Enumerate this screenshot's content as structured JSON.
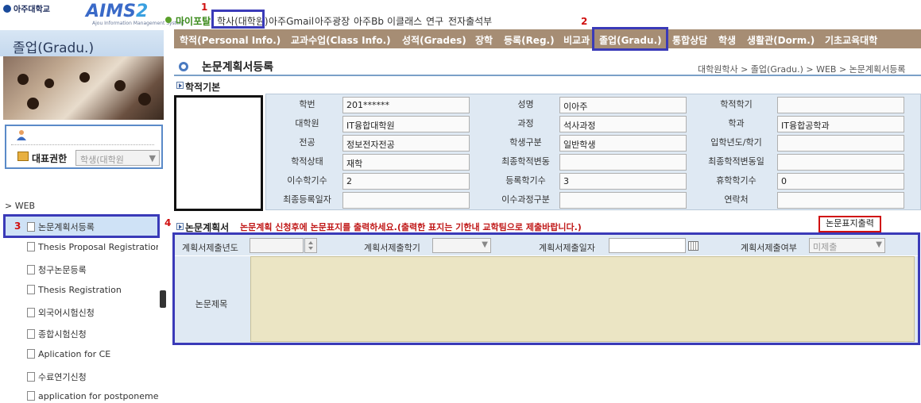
{
  "header": {
    "univ_name": "아주대학교",
    "brand": "AIMS",
    "brand_two": "2",
    "brand_sub": "Ajou Information Management System",
    "nav": [
      "마이포탈",
      "학사(대학원)",
      "아주Gmail",
      "아주광장",
      "아주Bb",
      "이클래스",
      "연구",
      "전자출석부"
    ]
  },
  "marks": [
    "1",
    "2",
    "3",
    "4"
  ],
  "sidebar": {
    "title": "졸업(Gradu.)",
    "rep_label": "대표권한",
    "rep_value": "학생(대학원",
    "rep_arrow": "▼",
    "web_label": "> WEB",
    "items": [
      "논문계획서등록",
      "Thesis Proposal Registration",
      "청구논문등록",
      "Thesis Registration",
      "외국어시험신청",
      "종합시험신청",
      "Aplication for CE",
      "수료연기신청",
      "application for postponement"
    ]
  },
  "tabs": [
    "학적(Personal Info.)",
    "교과수업(Class Info.)",
    "성적(Grades)",
    "장학",
    "등록(Reg.)",
    "비교과",
    "졸업(Gradu.)",
    "통합상담",
    "학생",
    "생활관(Dorm.)",
    "기초교육대학"
  ],
  "page": {
    "title": "논문계획서등록",
    "breadcrumb": "대학원학사 > 졸업(Gradu.) > WEB > 논문계획서등록"
  },
  "basic": {
    "section": "학적기본",
    "rows": [
      [
        {
          "l": "학번",
          "v": "201******"
        },
        {
          "l": "성명",
          "v": "이아주"
        },
        {
          "l": "학적학기",
          "v": ""
        }
      ],
      [
        {
          "l": "대학원",
          "v": "IT융합대학원"
        },
        {
          "l": "과정",
          "v": "석사과정"
        },
        {
          "l": "학과",
          "v": "IT융합공학과"
        }
      ],
      [
        {
          "l": "전공",
          "v": "정보전자전공"
        },
        {
          "l": "학생구분",
          "v": "일반학생"
        },
        {
          "l": "입학년도/학기",
          "v": ""
        }
      ],
      [
        {
          "l": "학적상태",
          "v": "재학"
        },
        {
          "l": "최종학적변동",
          "v": ""
        },
        {
          "l": "최종학적변동일",
          "v": ""
        }
      ],
      [
        {
          "l": "이수학기수",
          "v": "2"
        },
        {
          "l": "등록학기수",
          "v": "3"
        },
        {
          "l": "휴학학기수",
          "v": "0"
        }
      ],
      [
        {
          "l": "최종등록일자",
          "v": ""
        },
        {
          "l": "이수과정구분",
          "v": ""
        },
        {
          "l": "연락처",
          "v": ""
        }
      ]
    ]
  },
  "plan": {
    "section": "논문계획서",
    "note": "논문계획 신청후에 논문표지를 출력하세요.(출력한 표지는 기한내 교학팀으로 제출바랍니다.)",
    "print_button": "논문표지출력",
    "year_label": "계획서제출년도",
    "term_label": "계획서제출학기",
    "date_label": "계획서제출일자",
    "status_label": "계획서제출여부",
    "status_value": "미제출",
    "dd_arrow": "▼",
    "thesis_title_label": "논문제목"
  }
}
